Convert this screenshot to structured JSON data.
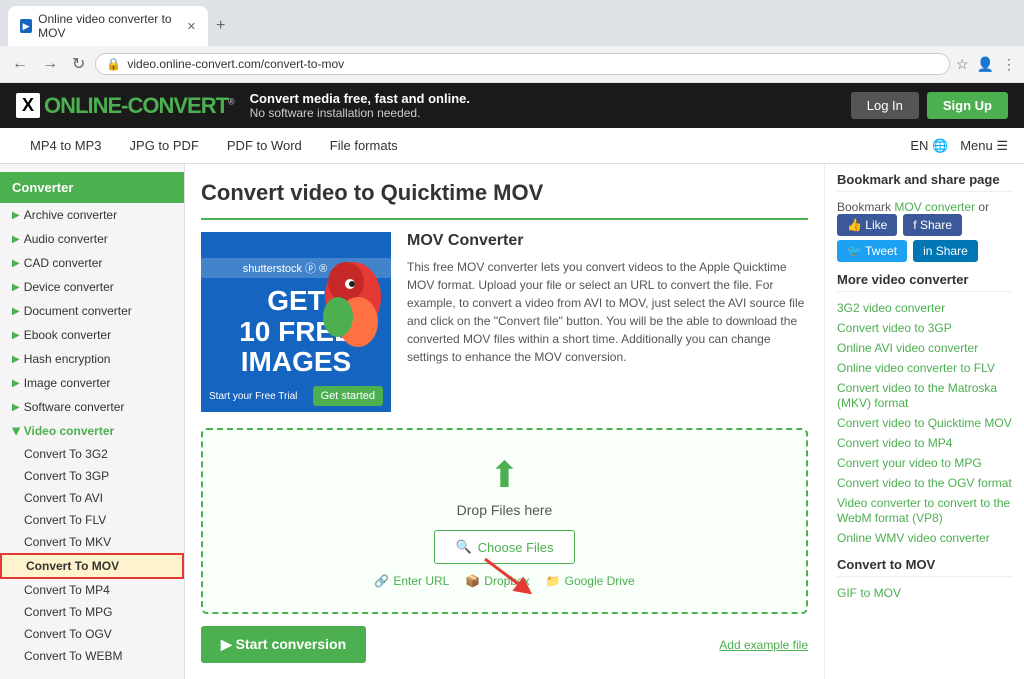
{
  "browser": {
    "tab_title": "Online video converter to MOV",
    "address": "video.online-convert.com/convert-to-mov",
    "new_tab_icon": "+"
  },
  "header": {
    "logo_icon": "X",
    "logo_name": "ONLINE",
    "logo_dash": "-",
    "logo_convert": "CONVERT",
    "logo_reg": "®",
    "tagline_main": "Convert media free, fast and online.",
    "tagline_sub": "No software installation needed.",
    "btn_login": "Log In",
    "btn_signup": "Sign Up"
  },
  "top_nav": {
    "links": [
      {
        "label": "MP4 to MP3"
      },
      {
        "label": "JPG to PDF"
      },
      {
        "label": "PDF to Word"
      },
      {
        "label": "File formats"
      }
    ],
    "lang": "EN",
    "menu": "Menu"
  },
  "sidebar": {
    "title": "Converter",
    "items": [
      {
        "label": "Archive converter",
        "expanded": false
      },
      {
        "label": "Audio converter",
        "expanded": false
      },
      {
        "label": "CAD converter",
        "expanded": false
      },
      {
        "label": "Device converter",
        "expanded": false
      },
      {
        "label": "Document converter",
        "expanded": false
      },
      {
        "label": "Ebook converter",
        "expanded": false
      },
      {
        "label": "Hash encryption",
        "expanded": false
      },
      {
        "label": "Image converter",
        "expanded": false
      },
      {
        "label": "Software converter",
        "expanded": false
      },
      {
        "label": "Video converter",
        "expanded": true
      }
    ],
    "subitems": [
      {
        "label": "Convert To 3G2"
      },
      {
        "label": "Convert To 3GP"
      },
      {
        "label": "Convert To AVI"
      },
      {
        "label": "Convert To FLV"
      },
      {
        "label": "Convert To MKV"
      },
      {
        "label": "Convert To MOV",
        "active": true
      },
      {
        "label": "Convert To MP4"
      },
      {
        "label": "Convert To MPG"
      },
      {
        "label": "Convert To OGV"
      },
      {
        "label": "Convert To WEBM"
      }
    ]
  },
  "main": {
    "page_title": "Convert video to Quicktime MOV",
    "ad": {
      "brand": "shutterstock ⓟ ® ◑ ⊞",
      "headline": "GET\n10 FREE\nIMAGES",
      "trial_text": "Start your Free Trial",
      "cta": "Get started"
    },
    "converter": {
      "title": "MOV Converter",
      "description": "This free MOV converter lets you convert videos to the Apple Quicktime MOV format. Upload your file or select an URL to convert the file. For example, to convert a video from AVI to MOV, just select the AVI source file and click on the \"Convert file\" button. You will be the able to download the converted MOV files within a short time. Additionally you can change settings to enhance the MOV conversion."
    },
    "dropzone": {
      "icon": "⬆",
      "text": "Drop Files here",
      "choose_btn": "Choose Files",
      "search_icon": "🔍",
      "actions": [
        {
          "icon": "🔗",
          "label": "Enter URL"
        },
        {
          "icon": "📦",
          "label": "Dropbox"
        },
        {
          "icon": "📁",
          "label": "Google Drive"
        }
      ]
    },
    "start_btn": "▶ Start conversion",
    "add_example": "Add example file"
  },
  "right_sidebar": {
    "bookmark_title": "Bookmark and share page",
    "bookmark_text": "Bookmark",
    "bookmark_link": "MOV converter",
    "bookmark_or": "or",
    "social_buttons": [
      {
        "label": "👍 Like",
        "type": "fb-like"
      },
      {
        "label": "f Share",
        "type": "fb-share"
      },
      {
        "label": "🐦 Tweet",
        "type": "tw-tweet"
      },
      {
        "label": "in Share",
        "type": "li-share"
      }
    ],
    "more_title": "More video converter",
    "more_links": [
      "3G2 video converter",
      "Convert video to 3GP",
      "Online AVI video converter",
      "Online video converter to FLV",
      "Convert video to the Matroska (MKV) format",
      "Convert video to Quicktime MOV",
      "Convert video to MP4",
      "Convert your video to MPG",
      "Convert video to the OGV format",
      "Video converter to convert to the WebM format (VP8)",
      "Online WMV video converter"
    ],
    "convert_title": "Convert to MOV",
    "convert_links": [
      "GIF to MOV"
    ]
  }
}
